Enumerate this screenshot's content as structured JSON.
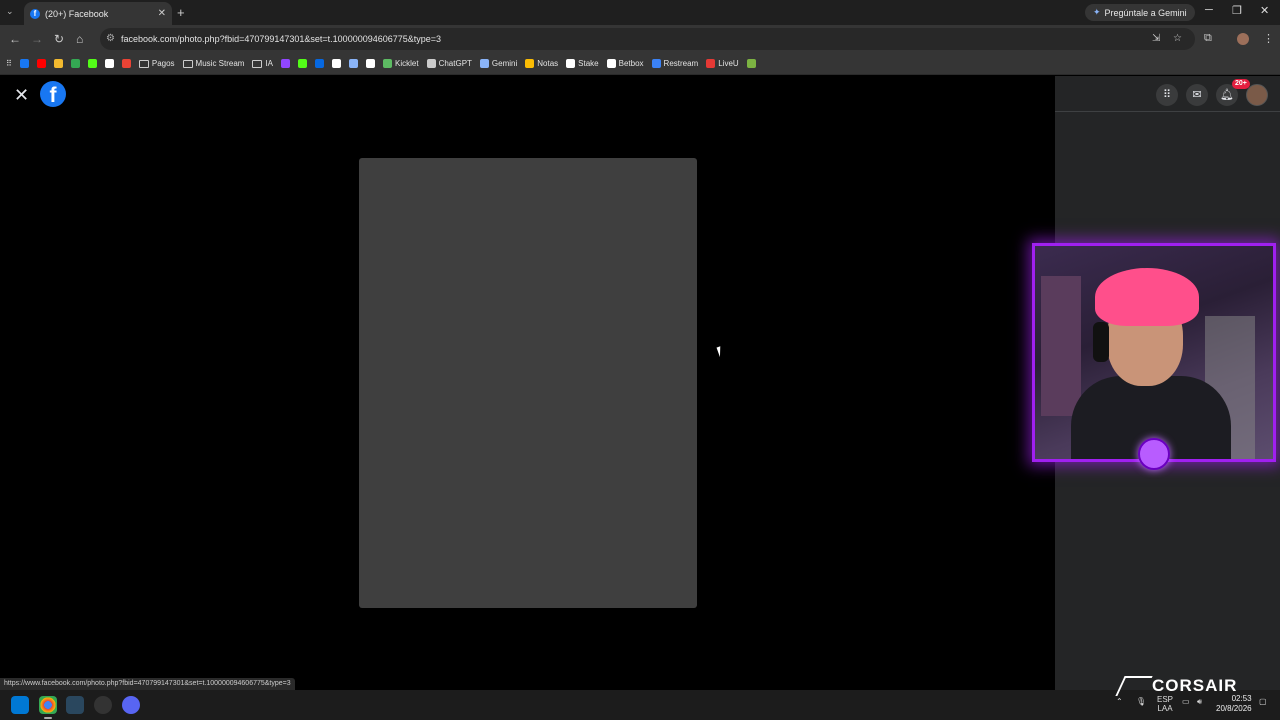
{
  "browser": {
    "tab": {
      "title": "(20+) Facebook"
    },
    "gemini_button": "Pregúntale a Gemini",
    "address": "facebook.com/photo.php?fbid=470799147301&set=t.100000094606775&type=3",
    "bookmarks": [
      {
        "label": "",
        "color": "#1877f2"
      },
      {
        "label": "",
        "color": "#ff0000"
      },
      {
        "label": "",
        "color": "#f3ba2f"
      },
      {
        "label": "",
        "color": "#34a853"
      },
      {
        "label": "",
        "color": "#53fc18"
      },
      {
        "label": "",
        "color": "#ffffff"
      },
      {
        "label": "",
        "color": "#ea4335"
      },
      {
        "label": "Pagos",
        "folder": true
      },
      {
        "label": "Music Stream",
        "folder": true
      },
      {
        "label": "IA",
        "folder": true
      },
      {
        "label": "",
        "color": "#9146ff"
      },
      {
        "label": "",
        "color": "#53fc18"
      },
      {
        "label": "",
        "color": "#0668e1"
      },
      {
        "label": "",
        "color": "#ffffff"
      },
      {
        "label": "",
        "color": "#8ab4f8"
      },
      {
        "label": "",
        "color": "#ffffff"
      },
      {
        "label": "Kicklet",
        "color": "#5dbb63"
      },
      {
        "label": "ChatGPT",
        "color": "#cccccc"
      },
      {
        "label": "Gemini",
        "color": "#8ab4f8"
      },
      {
        "label": "Notas",
        "color": "#fbbc04"
      },
      {
        "label": "Stake",
        "color": "#ffffff"
      },
      {
        "label": "Betbox",
        "color": "#ffffff"
      },
      {
        "label": "Restream",
        "color": "#3b82f6"
      },
      {
        "label": "LiveU",
        "color": "#e53935"
      },
      {
        "label": "",
        "color": "#7cb342"
      }
    ],
    "status_url": "https://www.facebook.com/photo.php?fbid=470799147301&set=t.100000094606775&type=3"
  },
  "facebook": {
    "logo_letter": "f",
    "notifications_badge": "20+"
  },
  "overlay": {
    "brand": "CORSAIR"
  },
  "taskbar": {
    "lang_top": "ESP",
    "lang_bottom": "LAA",
    "time": "02:53",
    "date": "20/8/2026"
  },
  "colors": {
    "facebook_blue": "#1877f2",
    "webcam_border": "#a020f0",
    "notif_red": "#e41e3f"
  }
}
